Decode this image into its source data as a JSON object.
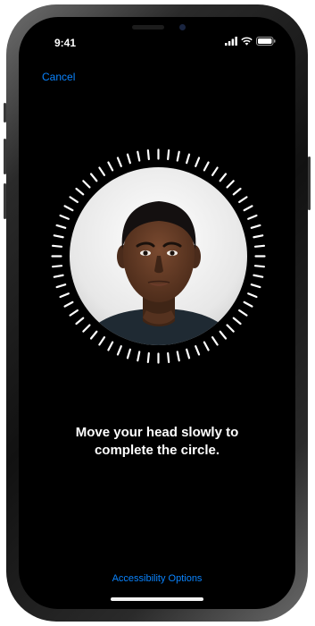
{
  "status_bar": {
    "time": "9:41",
    "icons": [
      "cellular-signal-icon",
      "wifi-icon",
      "battery-icon"
    ]
  },
  "nav": {
    "cancel_label": "Cancel"
  },
  "scan": {
    "icon": "face-scan-tick-ring",
    "photo": "user-face-photo"
  },
  "prompt": {
    "line1": "Move your head slowly to",
    "line2": "complete the circle."
  },
  "footer": {
    "accessibility_label": "Accessibility Options"
  },
  "colors": {
    "accent": "#0a84ff",
    "background": "#000000",
    "text": "#ffffff"
  }
}
